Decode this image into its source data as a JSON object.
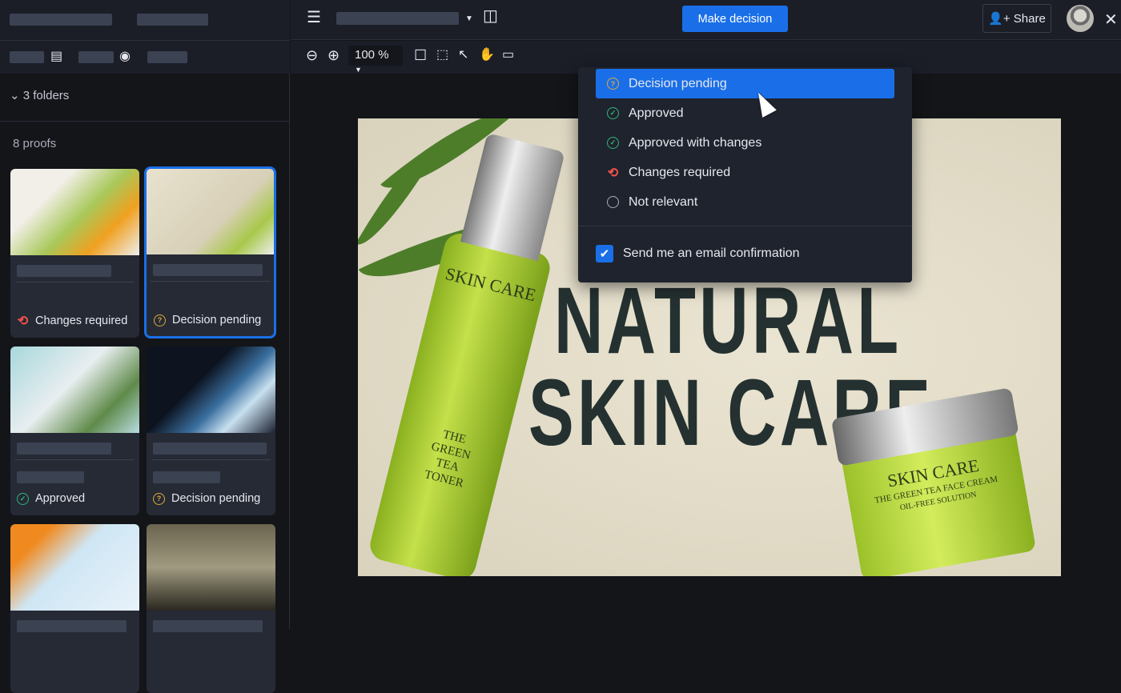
{
  "sidebar": {
    "folders_label": "3 folders",
    "proofs_label": "8 proofs",
    "cards": [
      {
        "status": "Changes required",
        "status_type": "changes"
      },
      {
        "status": "Decision pending",
        "status_type": "pending",
        "selected": true
      },
      {
        "status": "Approved",
        "status_type": "approved"
      },
      {
        "status": "Decision pending",
        "status_type": "pending"
      },
      {
        "status": null
      },
      {
        "status": null
      }
    ]
  },
  "toolbar": {
    "zoom": "100 %",
    "make_decision": "Make decision",
    "share": "Share"
  },
  "dropdown": {
    "options": [
      "Decision pending",
      "Approved",
      "Approved with changes",
      "Changes required",
      "Not relevant"
    ],
    "highlighted": "Decision pending",
    "email_label": "Send me an email confirmation",
    "email_checked": true
  },
  "artwork": {
    "headline1": "NATURAL",
    "headline2": "SKIN CARE",
    "bottle_label": "SKIN CARE",
    "bottle_sub": "THE GREEN TEA TONER",
    "jar_label": "SKIN CARE",
    "jar_sub": "THE GREEN TEA FACE CREAM",
    "jar_sub2": "OIL-FREE SOLUTION"
  },
  "colors": {
    "accent": "#1a6fe8",
    "pending": "#e0a93a",
    "approved": "#2fb67c",
    "changes": "#f0524a"
  }
}
